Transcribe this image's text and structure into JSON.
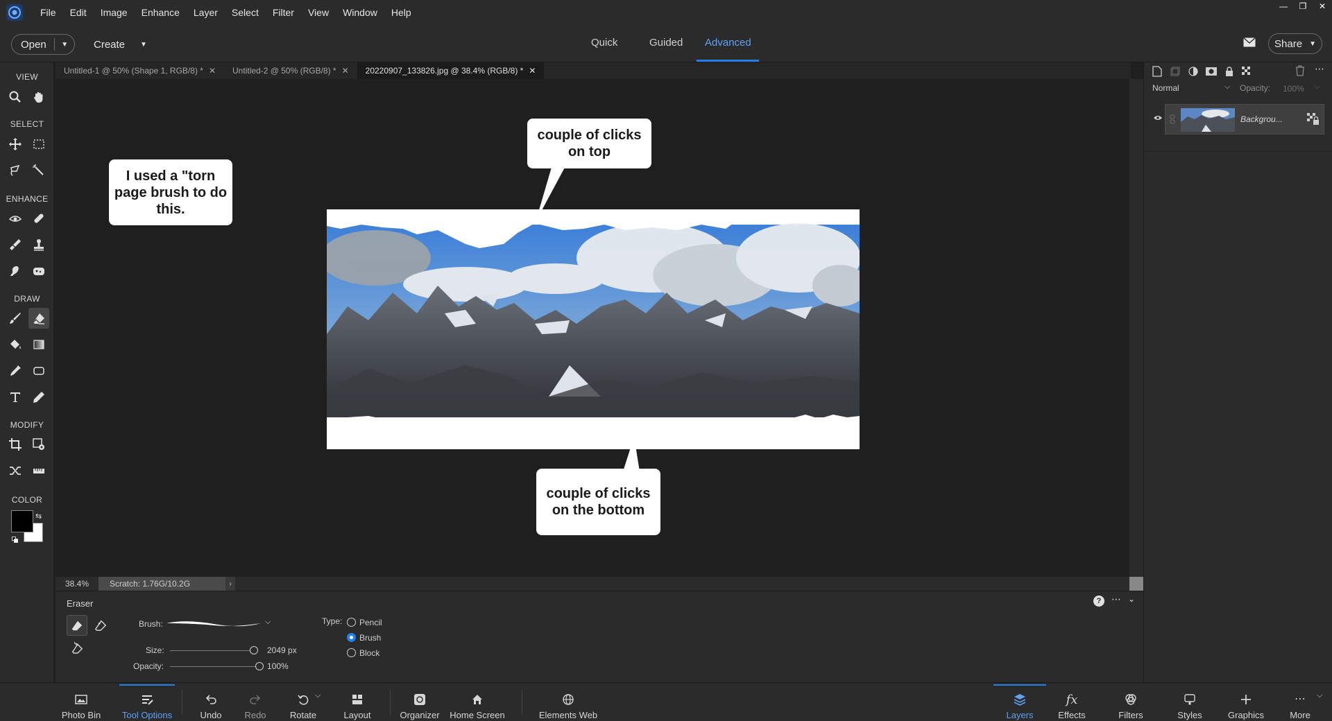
{
  "menu": [
    "File",
    "Edit",
    "Image",
    "Enhance",
    "Layer",
    "Select",
    "Filter",
    "View",
    "Window",
    "Help"
  ],
  "header": {
    "open_label": "Open",
    "create_label": "Create",
    "modes": [
      "Quick",
      "Guided",
      "Advanced"
    ],
    "active_mode": "Advanced",
    "share_label": "Share"
  },
  "toolbox": {
    "sections": [
      "VIEW",
      "SELECT",
      "ENHANCE",
      "DRAW",
      "MODIFY",
      "COLOR"
    ],
    "active_tool": "eraser",
    "foreground_color": "#000000",
    "background_color": "#ffffff"
  },
  "doc_tabs": [
    {
      "title": "Untitled-1 @ 50% (Shape 1, RGB/8) *"
    },
    {
      "title": "Untitled-2 @ 50% (RGB/8) *"
    },
    {
      "title": "20220907_133826.jpg @ 38.4% (RGB/8) *"
    }
  ],
  "canvas": {
    "callouts": {
      "left": "I used a \"torn page brush to do this.",
      "top": "couple of clicks on top",
      "bottom": "couple of clicks on the bottom"
    },
    "zoom": "38.4%",
    "scratch": "Scratch: 1.76G/10.2G"
  },
  "tool_options": {
    "title": "Eraser",
    "brush_label": "Brush:",
    "size_label": "Size:",
    "size_value": "2049 px",
    "size_level": 0.98,
    "opacity_label": "Opacity:",
    "opacity_value": "100%",
    "opacity_level": 1.0,
    "type_label": "Type:",
    "types": [
      "Pencil",
      "Brush",
      "Block"
    ],
    "selected_type": "Brush"
  },
  "taskbar": {
    "left": [
      "Photo Bin",
      "Tool Options",
      "Undo",
      "Redo",
      "Rotate",
      "Layout",
      "Organizer",
      "Home Screen",
      "Elements Web"
    ],
    "right": [
      "Layers",
      "Effects",
      "Filters",
      "Styles",
      "Graphics",
      "More"
    ],
    "active_left": "Tool Options",
    "active_right": "Layers"
  },
  "layers_panel": {
    "blend_mode": "Normal",
    "opacity_label": "Opacity:",
    "opacity_value": "100%",
    "layer_name": "Backgrou..."
  },
  "colors": {
    "accent": "#2680eb",
    "ui_bg": "#2b2b2b",
    "canvas_bg": "#1f1f1f"
  }
}
